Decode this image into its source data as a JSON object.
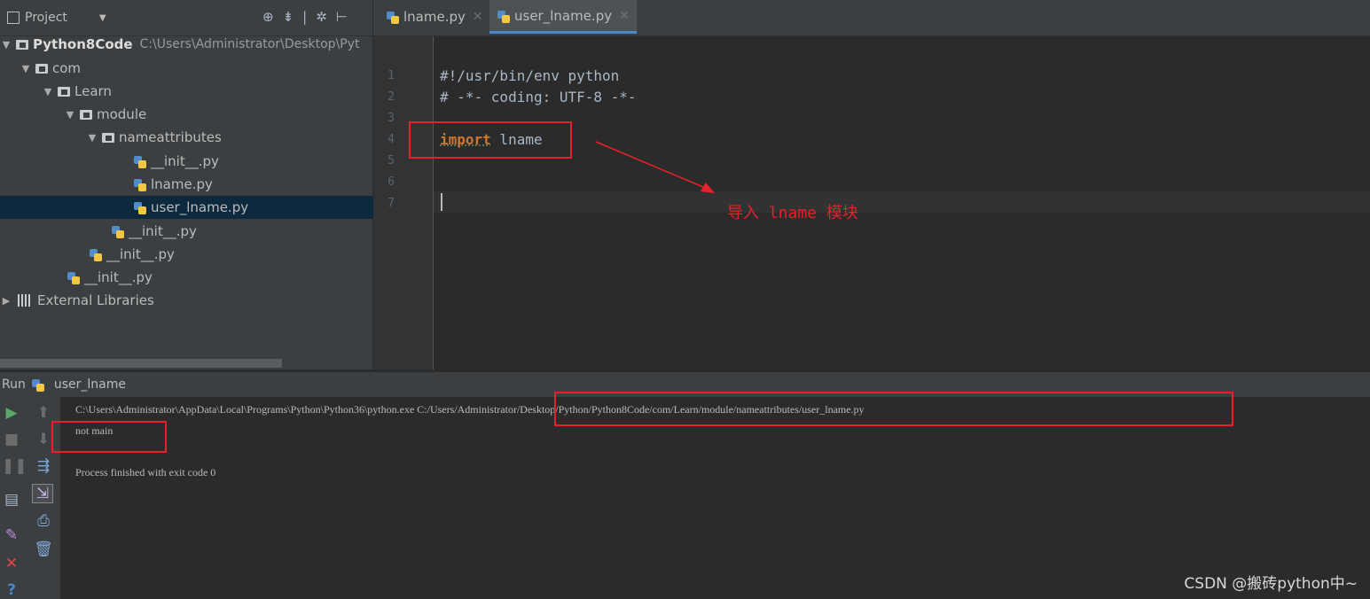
{
  "project": {
    "title": "Project",
    "tree": [
      {
        "label": "Python8Code",
        "path": "C:\\Users\\Administrator\\Desktop\\Pyt",
        "kind": "root"
      },
      {
        "label": "com",
        "kind": "folder"
      },
      {
        "label": "Learn",
        "kind": "folder"
      },
      {
        "label": "module",
        "kind": "folder"
      },
      {
        "label": "nameattributes",
        "kind": "folder"
      },
      {
        "label": "__init__.py",
        "kind": "file"
      },
      {
        "label": "lname.py",
        "kind": "file"
      },
      {
        "label": "user_lname.py",
        "kind": "file",
        "selected": true
      },
      {
        "label": "__init__.py",
        "kind": "file"
      },
      {
        "label": "__init__.py",
        "kind": "file"
      },
      {
        "label": "__init__.py",
        "kind": "file"
      },
      {
        "label": "External Libraries",
        "kind": "library"
      }
    ]
  },
  "tabs": [
    {
      "label": "lname.py",
      "active": false
    },
    {
      "label": "user_lname.py",
      "active": true
    }
  ],
  "editor": {
    "line_numbers": [
      "1",
      "2",
      "3",
      "4",
      "5",
      "6",
      "7"
    ],
    "line1": "#!/usr/bin/env python",
    "line2": "# -*- coding: UTF-8 -*-",
    "import_kw": "import",
    "import_mod": " lname"
  },
  "annotation": "导入 lname 模块",
  "run": {
    "label": "Run",
    "config": "user_lname",
    "command_exe": "C:\\Users\\Administrator\\AppData\\Local\\Programs\\Python\\Python36\\python.exe",
    "command_script": "C:/Users/Administrator/Desktop/Python/Python8Code/com/Learn/module/nameattributes/user_lname.py",
    "output": "not main",
    "finished": "Process finished with exit code 0"
  },
  "watermark": "CSDN @搬砖python中~",
  "colors": {
    "accent": "#4a88c7",
    "annotation_red": "#e8202a",
    "keyword": "#cc7832"
  }
}
